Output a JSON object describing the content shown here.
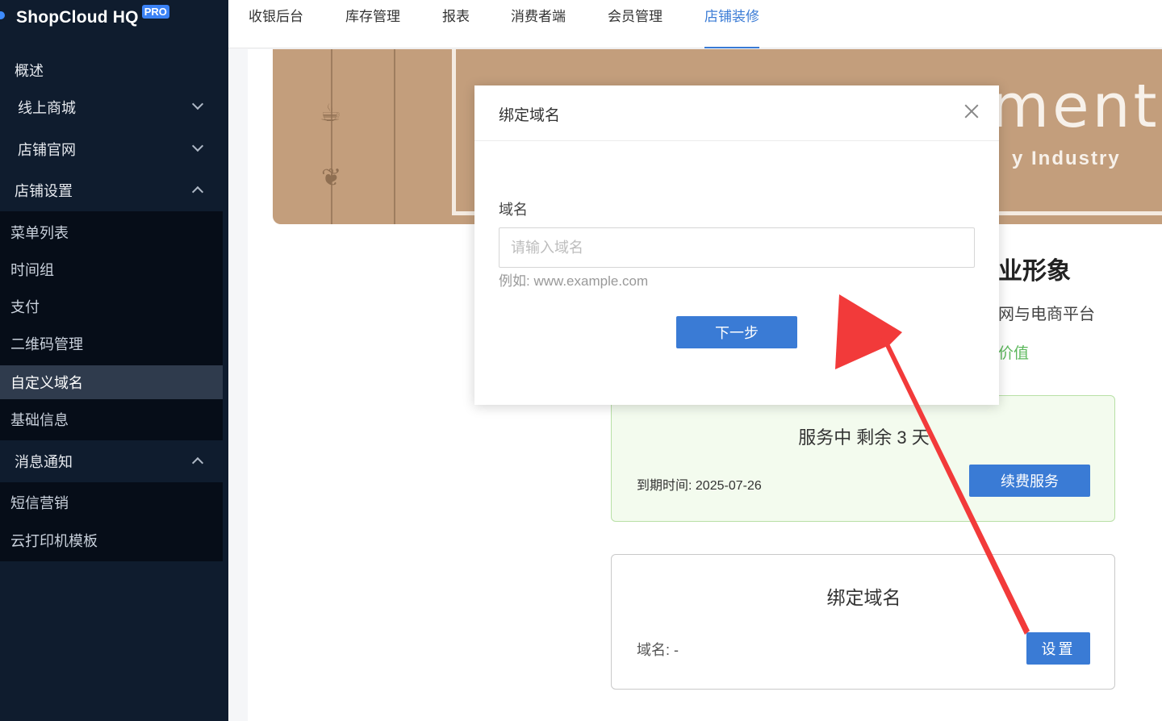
{
  "brand": {
    "name": "ShopCloud HQ",
    "badge": "PRO"
  },
  "sidebar": {
    "items": [
      {
        "label": "概述"
      },
      {
        "label": "线上商城"
      },
      {
        "label": "店铺官网"
      },
      {
        "label": "店铺设置"
      },
      {
        "label": "消息通知"
      }
    ],
    "store_settings_sub": [
      {
        "label": "菜单列表"
      },
      {
        "label": "时间组"
      },
      {
        "label": "支付"
      },
      {
        "label": "二维码管理"
      },
      {
        "label": "自定义域名"
      },
      {
        "label": "基础信息"
      }
    ],
    "notify_sub": [
      {
        "label": "短信营销"
      },
      {
        "label": "云打印机模板"
      }
    ]
  },
  "topnav": {
    "tabs": [
      {
        "label": "收银后台"
      },
      {
        "label": "库存管理"
      },
      {
        "label": "报表"
      },
      {
        "label": "消费者端"
      },
      {
        "label": "会员管理"
      },
      {
        "label": "店铺装修"
      }
    ],
    "active_tab": "店铺装修"
  },
  "banner": {
    "big_text": "ment",
    "sub_text": "y Industry"
  },
  "main": {
    "heading_fragment": "业形象",
    "desc_fragment": "网与电商平台",
    "value_fragment": "价值"
  },
  "service_card": {
    "status": "服务中  剩余 3",
    "status_tail": "天",
    "expire_text": "到期时间: 2025-07-26",
    "renew_label": "续费服务"
  },
  "domain_card": {
    "title": "绑定域名",
    "domain_label": "域名:   -",
    "set_label": "设置"
  },
  "modal": {
    "title": "绑定域名",
    "field_label": "域名",
    "input_placeholder": "请输入域名",
    "input_value": "",
    "hint": "例如: www.example.com",
    "next_label": "下一步"
  },
  "colors": {
    "sidebar_bg": "#0f1c2e",
    "accent": "#3a7bd5",
    "annotation_arrow": "#f23a3a",
    "service_green": "#f3fbee"
  }
}
